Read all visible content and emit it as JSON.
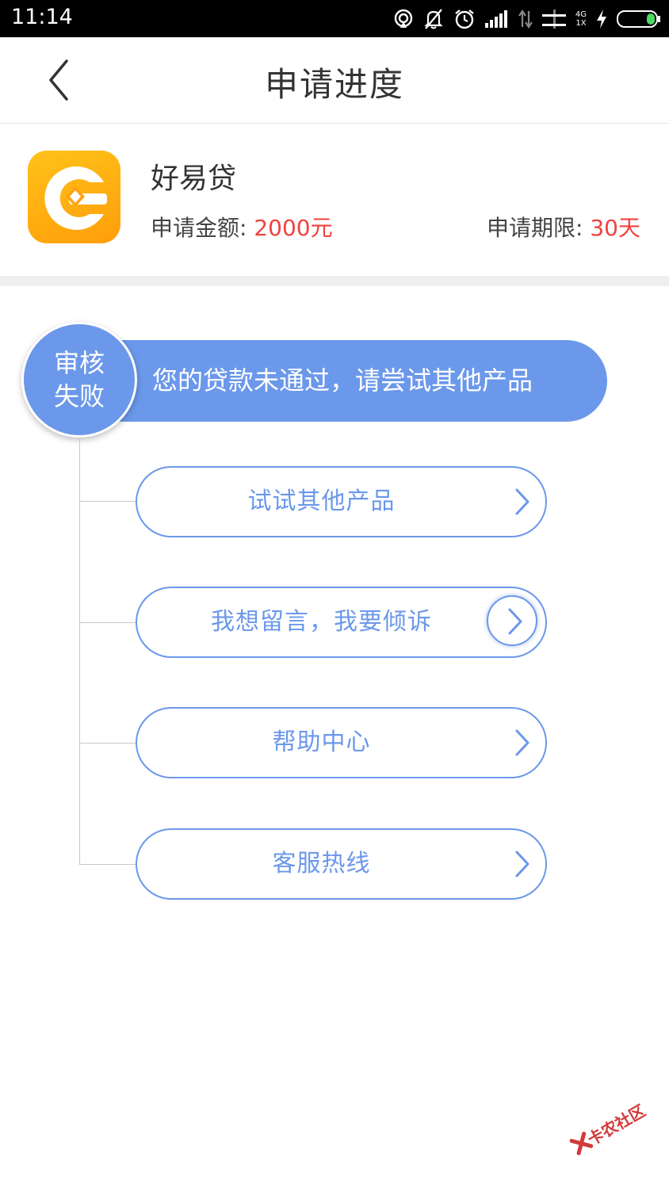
{
  "status_bar": {
    "time": "11:14",
    "network_top": "4G",
    "network_bottom": "1X"
  },
  "header": {
    "title": "申请进度"
  },
  "product": {
    "name": "好易贷",
    "amount_label": "申请金额:",
    "amount_value": "2000元",
    "term_label": "申请期限:",
    "term_value": "30天"
  },
  "status": {
    "badge_line1": "审核",
    "badge_line2": "失败",
    "message": "您的贷款未通过，请尝试其他产品",
    "color": "#6b98ea"
  },
  "actions": [
    {
      "label": "试试其他产品"
    },
    {
      "label": "我想留言，我要倾诉"
    },
    {
      "label": "帮助中心"
    },
    {
      "label": "客服热线"
    }
  ],
  "watermark": {
    "text": "卡农社区"
  },
  "colors": {
    "accent": "#6b98ea",
    "highlight_red": "#f0413f",
    "logo_orange": "#ffb213"
  }
}
